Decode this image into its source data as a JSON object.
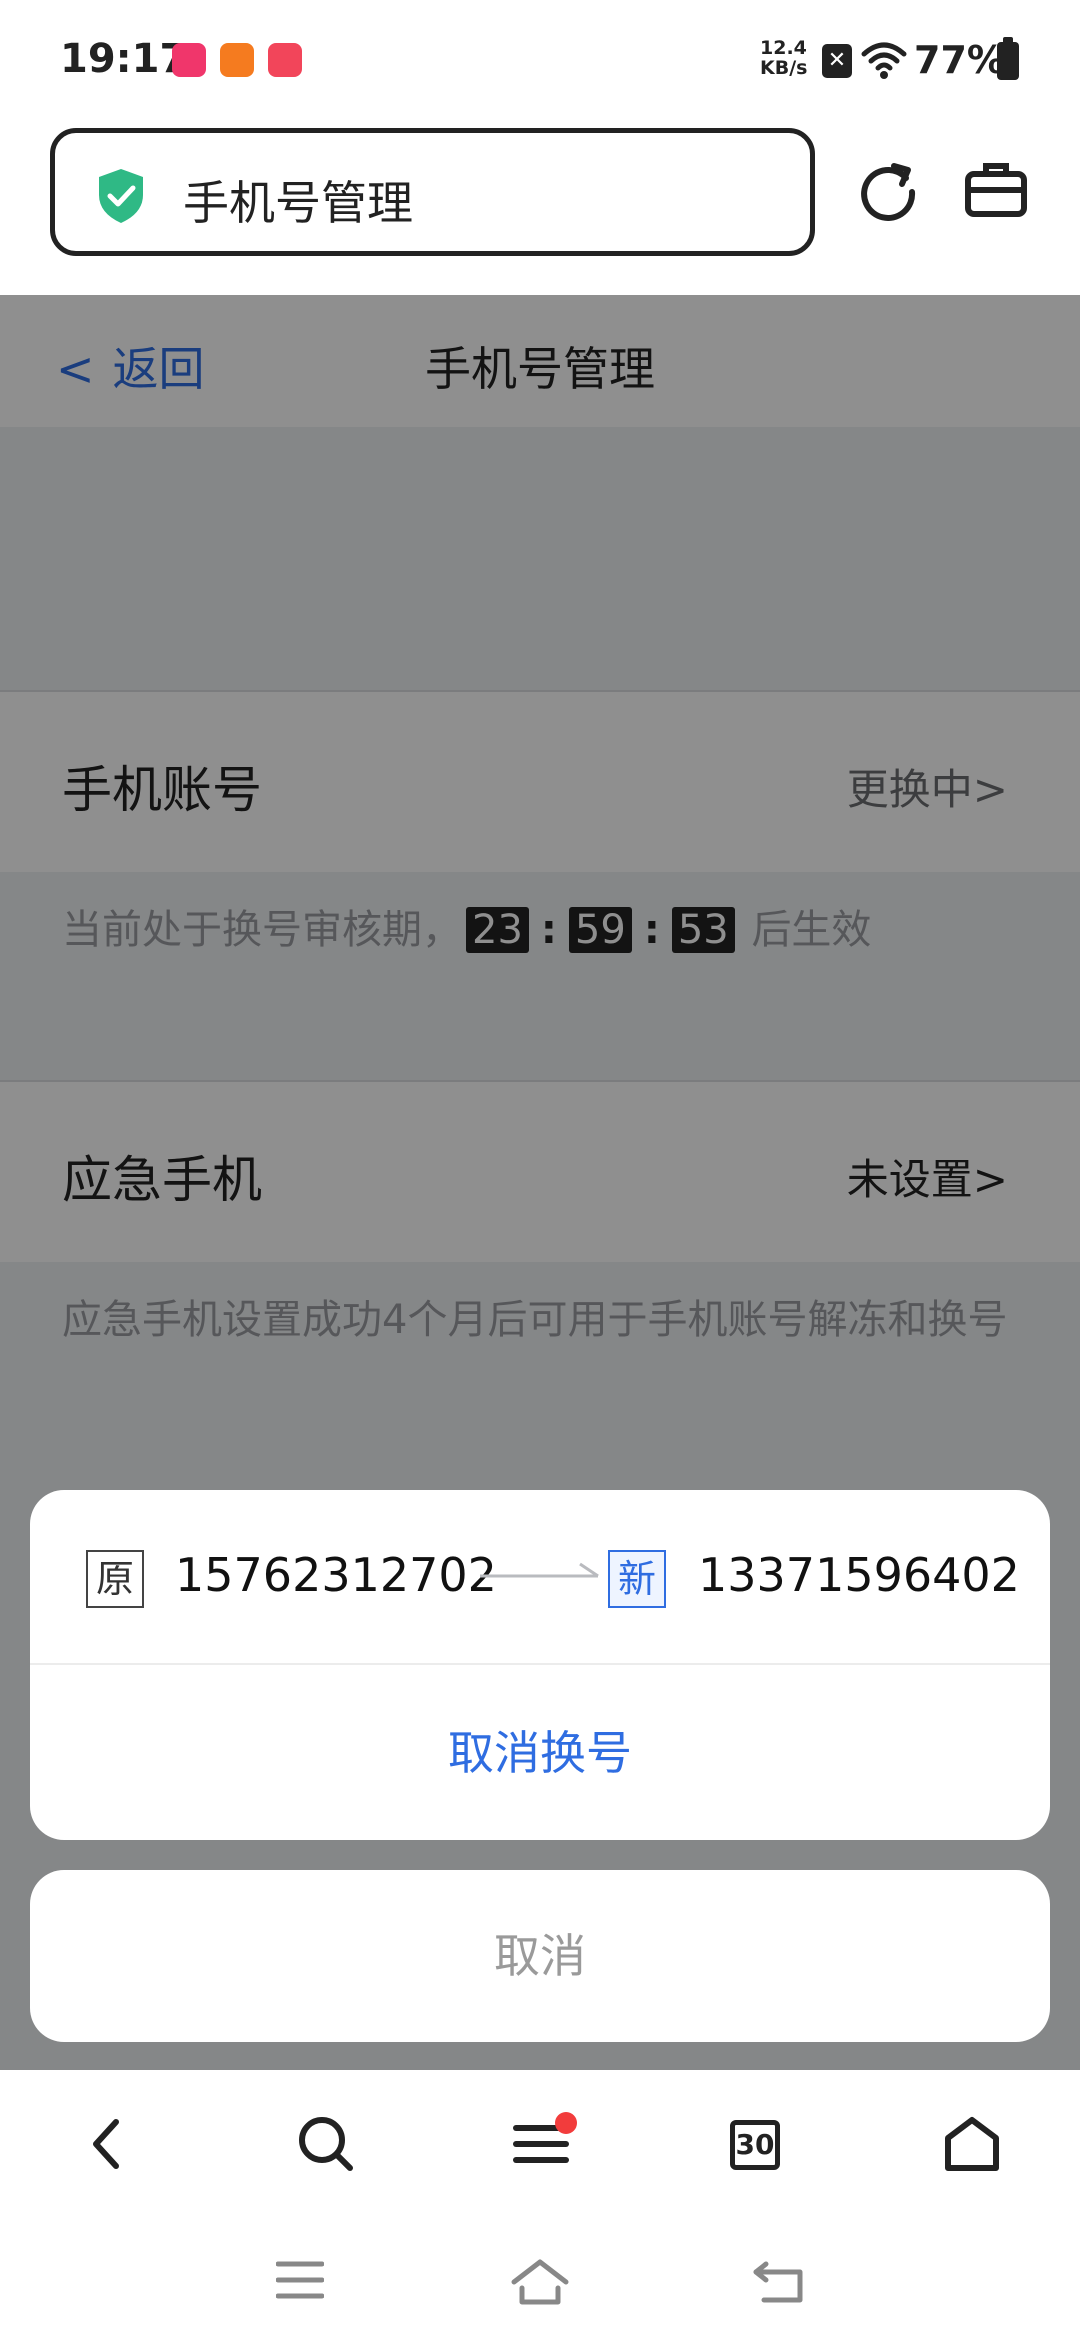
{
  "status_bar": {
    "time": "19:17",
    "net_speed_value": "12.4",
    "net_speed_unit": "KB/s",
    "battery": "77%",
    "app_icon_colors": [
      "#f0366b",
      "#f57b1f",
      "#f2455a"
    ]
  },
  "browser": {
    "url_title": "手机号管理",
    "secure_icon": "shield-check-icon",
    "refresh_icon": "refresh-icon",
    "toolbox_icon": "toolbox-icon"
  },
  "page": {
    "back_label": "返回",
    "title": "手机号管理",
    "phone_account": {
      "label": "手机账号",
      "status": "更换中>"
    },
    "review_hint": {
      "prefix": "当前处于换号审核期，",
      "hours": "23",
      "minutes": "59",
      "seconds": "53",
      "separator": ":",
      "suffix": "后生效"
    },
    "emergency_phone": {
      "label": "应急手机",
      "status": "未设置>"
    },
    "emergency_hint": "应急手机设置成功4个月后可用于手机账号解冻和换号"
  },
  "action_sheet": {
    "old_tag": "原",
    "old_number": "15762312702",
    "new_tag": "新",
    "new_number": "13371596402",
    "cancel_change": "取消换号",
    "cancel": "取消"
  },
  "bottom_nav": {
    "tab_count": "30"
  },
  "colors": {
    "accent": "#2f6de1",
    "overlay": "rgba(0,0,0,0.44)",
    "badge_red": "#f23c3c",
    "shield_green": "#2fb985"
  }
}
